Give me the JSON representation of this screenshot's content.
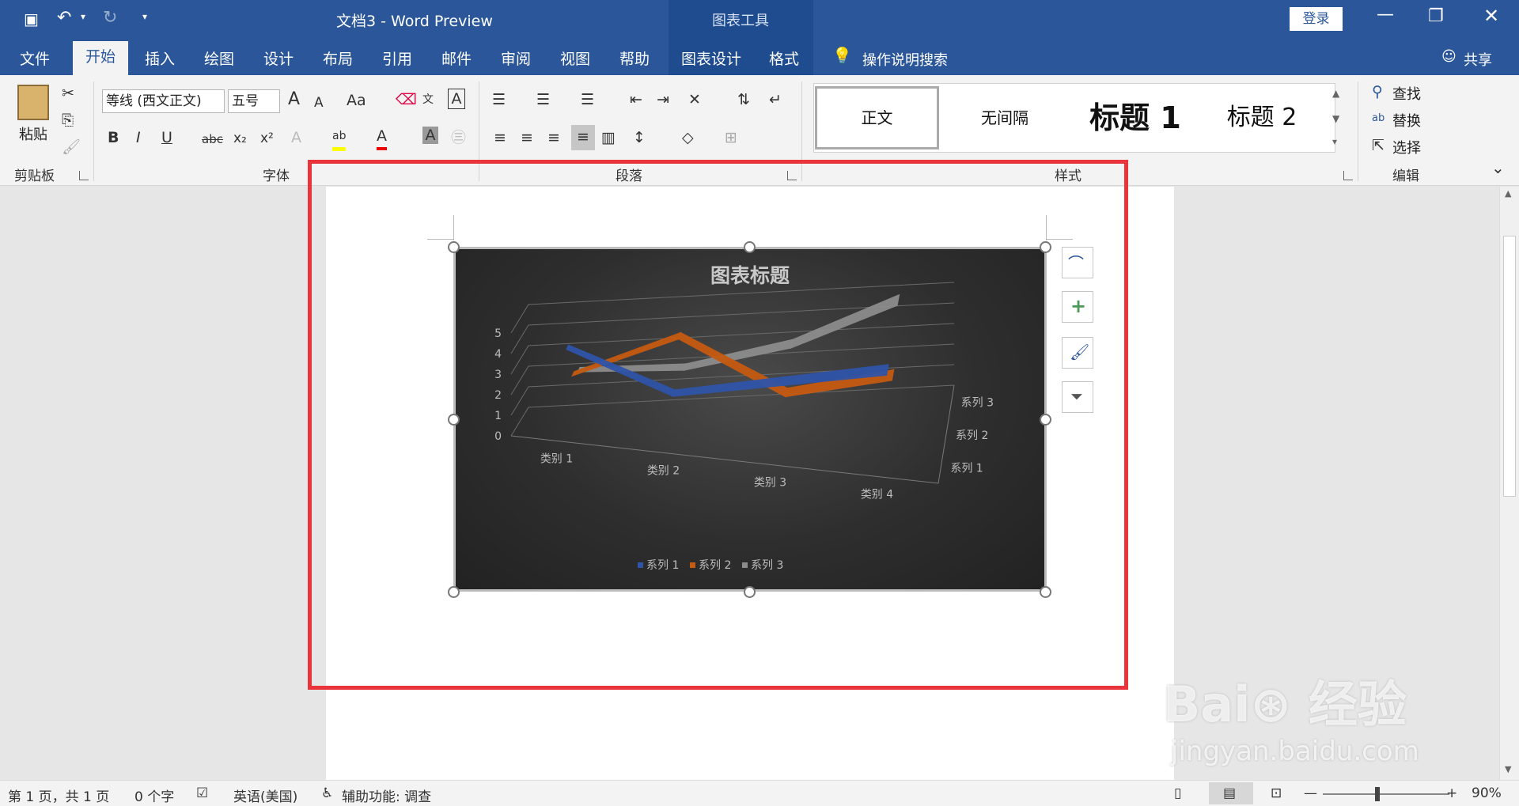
{
  "title_bar": {
    "doc_title": "文档3  -  Word Preview",
    "context_tools": "图表工具",
    "login": "登录"
  },
  "tabs": [
    "文件",
    "开始",
    "插入",
    "绘图",
    "设计",
    "布局",
    "引用",
    "邮件",
    "审阅",
    "视图",
    "帮助",
    "图表设计",
    "格式"
  ],
  "tell_me": "操作说明搜索",
  "share": "共享",
  "clipboard": {
    "paste": "粘贴",
    "group_label": "剪贴板"
  },
  "font": {
    "family": "等线 (西文正文)",
    "size": "五号",
    "case_label": "Aa",
    "bold": "B",
    "italic": "I",
    "underline": "U",
    "strike": "abc",
    "sub": "x₂",
    "sup": "x²",
    "group_label": "字体"
  },
  "paragraph": {
    "group_label": "段落"
  },
  "styles": {
    "items": [
      "正文",
      "无间隔",
      "标题 1",
      "标题 2"
    ],
    "group_label": "样式"
  },
  "editing": {
    "find": "查找",
    "replace": "替换",
    "select": "选择",
    "group_label": "编辑"
  },
  "chart_data": {
    "type": "line",
    "variant": "3d",
    "title": "图表标题",
    "categories": [
      "类别 1",
      "类别 2",
      "类别 3",
      "类别 4"
    ],
    "series": [
      {
        "name": "系列 1",
        "color": "#2f54a8",
        "values": [
          4.3,
          2.5,
          3.5,
          4.5
        ]
      },
      {
        "name": "系列 2",
        "color": "#c55a11",
        "values": [
          2.4,
          4.4,
          1.8,
          2.8
        ]
      },
      {
        "name": "系列 3",
        "color": "#8c8c8c",
        "values": [
          2.0,
          2.0,
          3.0,
          5.0
        ]
      }
    ],
    "yticks": [
      "0",
      "1",
      "2",
      "3",
      "4",
      "5"
    ],
    "depth_labels": [
      "系列 3",
      "系列 2",
      "系列 1"
    ],
    "ylim": [
      0,
      5
    ],
    "legend": "bottom"
  },
  "status": {
    "page": "第 1 页，共 1 页",
    "words": "0 个字",
    "lang": "英语(美国)",
    "access": "辅助功能: 调查",
    "zoom": "90%"
  }
}
